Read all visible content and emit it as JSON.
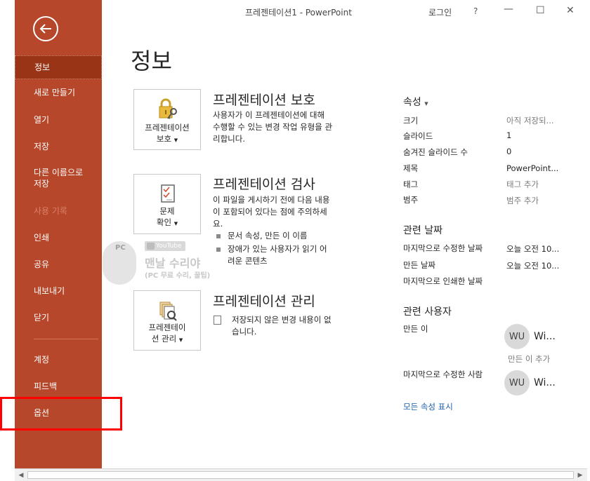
{
  "window": {
    "title": "프레젠테이션1  -  PowerPoint",
    "login": "로그인",
    "help": "?",
    "minimize": "—",
    "maximize": "☐",
    "close": "✕"
  },
  "sidebar": {
    "back_icon": "back-arrow-icon",
    "items": [
      {
        "label": "정보"
      },
      {
        "label": "새로 만들기"
      },
      {
        "label": "열기"
      },
      {
        "label": "저장"
      },
      {
        "label": "다른 이름으로 저장"
      },
      {
        "label": "사용 기록"
      },
      {
        "label": "인쇄"
      },
      {
        "label": "공유"
      },
      {
        "label": "내보내기"
      },
      {
        "label": "닫기"
      },
      {
        "label": "계정"
      },
      {
        "label": "피드백"
      },
      {
        "label": "옵션"
      }
    ]
  },
  "main": {
    "page_title": "정보",
    "protect": {
      "tile_line1": "프레젠테이션",
      "tile_line2": "보호",
      "title": "프레젠테이션 보호",
      "desc_line1": "사용자가 이 프레젠테이션에 대해",
      "desc_line2": "수행할 수 있는 변경 작업 유형을 관",
      "desc_line3": "리합니다."
    },
    "inspect": {
      "tile_line1": "문제",
      "tile_line2": "확인",
      "title": "프레젠테이션 검사",
      "desc_line1": "이 파일을 게시하기 전에 다음 내용",
      "desc_line2": "이 포함되어 있다는 점에 주의하세",
      "desc_line3": "요.",
      "bullet1": "문서 속성, 만든 이 이름",
      "bullet2_line1": "장애가 있는 사용자가 읽기 어",
      "bullet2_line2": "려운 콘텐츠"
    },
    "manage": {
      "tile_line1": "프레젠테이",
      "tile_line2": "션 관리",
      "title": "프레젠테이션 관리",
      "desc_line1": "저장되지 않은 변경 내용이 없",
      "desc_line2": "습니다."
    },
    "watermark": {
      "badge": "PC",
      "youtube": "YouTube",
      "line1": "맨날 수리야",
      "line2": "(PC 무료 수리, 꿀팁)"
    }
  },
  "properties": {
    "heading": "속성",
    "rows": [
      {
        "label": "크기",
        "value": "아직 저장되..."
      },
      {
        "label": "슬라이드",
        "value": "1"
      },
      {
        "label": "숨겨진 슬라이드 수",
        "value": "0"
      },
      {
        "label": "제목",
        "value": "PowerPoint..."
      },
      {
        "label": "태그",
        "value": "태그 추가"
      },
      {
        "label": "범주",
        "value": "범주 추가"
      }
    ],
    "dates_heading": "관련 날짜",
    "dates": [
      {
        "label": "마지막으로 수정한 날짜",
        "value": "오늘 오전 10..."
      },
      {
        "label": "만든 날짜",
        "value": "오늘 오전 10..."
      },
      {
        "label": "마지막으로 인쇄한 날짜",
        "value": ""
      }
    ],
    "people_heading": "관련 사용자",
    "author_label": "만든 이",
    "author_initials": "WU",
    "author_name": "Wi...",
    "add_author": "만든 이 추가",
    "modified_by_label": "마지막으로 수정한 사람",
    "modified_initials": "WU",
    "modified_name": "Wi...",
    "show_all": "모든 속성 표시"
  }
}
